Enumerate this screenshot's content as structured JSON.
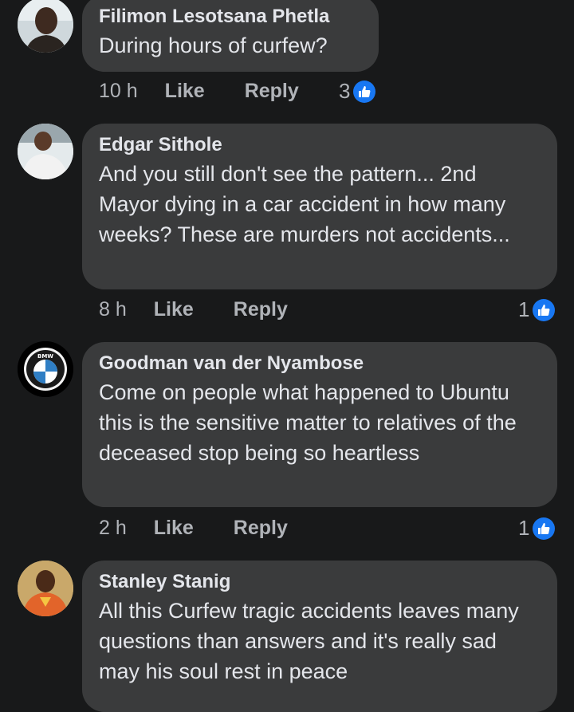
{
  "comments": [
    {
      "author": "Filimon Lesotsana Phetla",
      "text": "During hours of curfew?",
      "time": "10 h",
      "like": "Like",
      "reply": "Reply",
      "reactions": "3",
      "reaction_icon": "thumbs-up-icon",
      "avatar_icon": "person-avatar"
    },
    {
      "author": "Edgar Sithole",
      "text": "And you still don't see the pattern... 2nd Mayor dying in a car accident in how many weeks? These are murders not accidents...",
      "time": "8 h",
      "like": "Like",
      "reply": "Reply",
      "reactions": "1",
      "reaction_icon": "thumbs-up-icon",
      "avatar_icon": "person-avatar"
    },
    {
      "author": "Goodman van der Nyambose",
      "text": "Come on people what happened to Ubuntu this is the sensitive matter to relatives of the deceased stop being so heartless",
      "time": "2 h",
      "like": "Like",
      "reply": "Reply",
      "reactions": "1",
      "reaction_icon": "thumbs-up-icon",
      "avatar_icon": "bmw-logo-avatar",
      "avatar_logo_text": "BMW"
    },
    {
      "author": "Stanley Stanig",
      "text": "All this Curfew tragic accidents leaves many questions than answers and it's really sad may his soul rest in peace",
      "avatar_icon": "person-avatar"
    }
  ],
  "colors": {
    "background": "#18191a",
    "bubble": "#3a3b3c",
    "text": "#e4e6eb",
    "meta": "#b0b3b8",
    "like_blue": "#1877f2"
  }
}
